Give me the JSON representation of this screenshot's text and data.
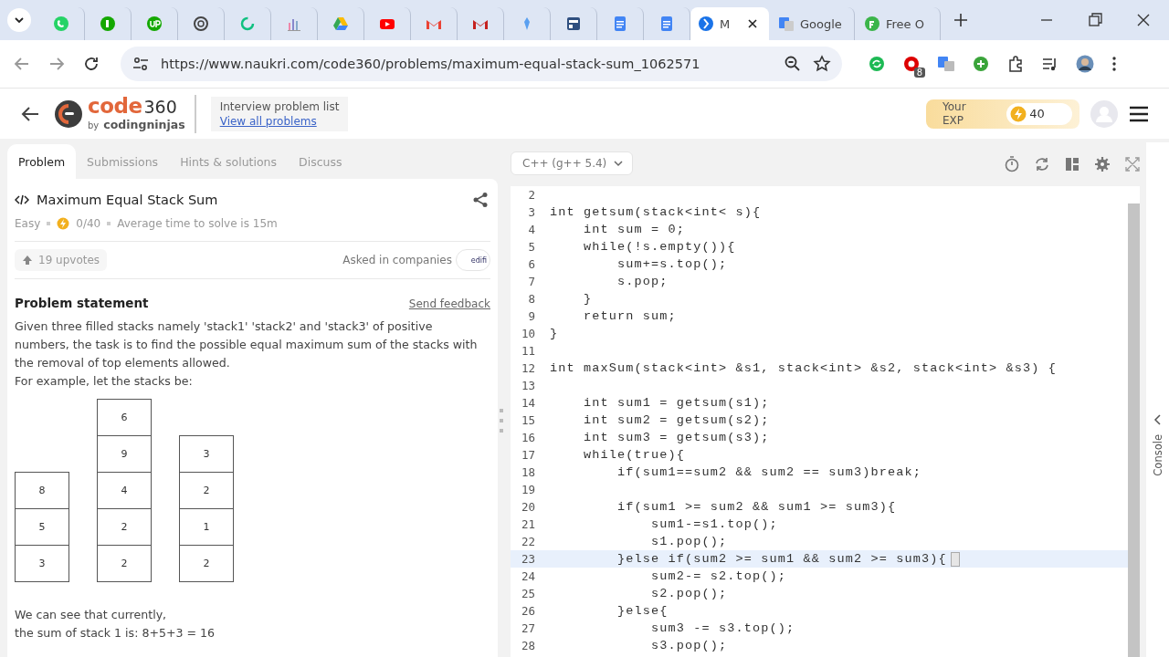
{
  "browser": {
    "tabs": [
      {
        "selected": false
      },
      {
        "selected": false
      },
      {
        "selected": false
      },
      {
        "selected": false
      },
      {
        "selected": false
      },
      {
        "selected": false
      },
      {
        "selected": false
      },
      {
        "selected": false
      },
      {
        "selected": false
      },
      {
        "selected": false
      },
      {
        "selected": false
      },
      {
        "selected": false
      },
      {
        "selected": false
      },
      {
        "selected": false
      },
      {
        "title": "M",
        "selected": true
      },
      {
        "title": "Google",
        "selected": false
      },
      {
        "title": "Free O",
        "selected": false
      }
    ],
    "url": "https://www.naukri.com/code360/problems/maximum-equal-stack-sum_1062571",
    "extension_badge": "8"
  },
  "header": {
    "logo": {
      "word": "code",
      "number": "360",
      "by": "by",
      "brand": "codingninjas"
    },
    "nav_title": "Interview problem list",
    "nav_link": "View all problems",
    "exp": {
      "label": "Your EXP",
      "value": "40"
    }
  },
  "problem": {
    "tabs": [
      {
        "label": "Problem",
        "selected": true
      },
      {
        "label": "Submissions",
        "selected": false
      },
      {
        "label": "Hints & solutions",
        "selected": false
      },
      {
        "label": "Discuss",
        "selected": false
      }
    ],
    "title": "Maximum Equal Stack Sum",
    "difficulty": "Easy",
    "score": "0/40",
    "avg_time": "Average time to solve is 15m",
    "upvotes": "19 upvotes",
    "companies_label": "Asked in companies",
    "company": "edifi",
    "statement_heading": "Problem statement",
    "feedback_link": "Send feedback",
    "paragraphs": [
      "Given three filled stacks namely 'stack1' 'stack2' and 'stack3' of positive numbers, the task is to find the possible equal maximum sum of the stacks with the removal of top elements allowed.",
      "For example, let the stacks be:"
    ],
    "stacks": [
      {
        "cells": [
          "8",
          "5",
          "3"
        ]
      },
      {
        "cells": [
          "6",
          "9",
          "4",
          "2",
          "2"
        ]
      },
      {
        "cells": [
          "3",
          "2",
          "1",
          "2"
        ]
      }
    ],
    "after": [
      "We can see that currently,",
      "the sum of stack 1 is: 8+5+3 = 16"
    ]
  },
  "editor": {
    "language": "C++ (g++ 5.4)",
    "console_label": "Console",
    "lines": [
      {
        "n": "2",
        "current": false
      },
      {
        "n": "3",
        "text": "int getsum(stack<int< s){",
        "current": false
      },
      {
        "n": "4",
        "text": "    int sum = 0;",
        "current": false
      },
      {
        "n": "5",
        "text": "    while(!s.empty()){",
        "current": false
      },
      {
        "n": "6",
        "text": "        sum+=s.top();",
        "current": false
      },
      {
        "n": "7",
        "text": "        s.pop;",
        "current": false
      },
      {
        "n": "8",
        "text": "    }",
        "current": false
      },
      {
        "n": "9",
        "text": "    return sum;",
        "current": false
      },
      {
        "n": "10",
        "text": "}",
        "current": false
      },
      {
        "n": "11",
        "current": false
      },
      {
        "n": "12",
        "text": "int maxSum(stack<int> &s1, stack<int> &s2, stack<int> &s3) {",
        "current": false
      },
      {
        "n": "13",
        "current": false
      },
      {
        "n": "14",
        "text": "    int sum1 = getsum(s1);",
        "current": false
      },
      {
        "n": "15",
        "text": "    int sum2 = getsum(s2);",
        "current": false
      },
      {
        "n": "16",
        "text": "    int sum3 = getsum(s3);",
        "current": false
      },
      {
        "n": "17",
        "text": "    while(true){",
        "current": false
      },
      {
        "n": "18",
        "text": "        if(sum1==sum2 && sum2 == sum3)break;",
        "current": false
      },
      {
        "n": "19",
        "current": false
      },
      {
        "n": "20",
        "text": "        if(sum1 >= sum2 && sum1 >= sum3){",
        "current": false
      },
      {
        "n": "21",
        "text": "            sum1-=s1.top();",
        "current": false
      },
      {
        "n": "22",
        "text": "            s1.pop();",
        "current": false
      },
      {
        "n": "23",
        "text": "        }else if(sum2 >= sum1 && sum2 >= sum3){",
        "current": true
      },
      {
        "n": "24",
        "text": "            sum2-= s2.top();",
        "current": false
      },
      {
        "n": "25",
        "text": "            s2.pop();",
        "current": false
      },
      {
        "n": "26",
        "text": "        }else{",
        "current": false
      },
      {
        "n": "27",
        "text": "            sum3 -= s3.top();",
        "current": false
      },
      {
        "n": "28",
        "text": "            s3.pop();",
        "current": false
      }
    ]
  }
}
